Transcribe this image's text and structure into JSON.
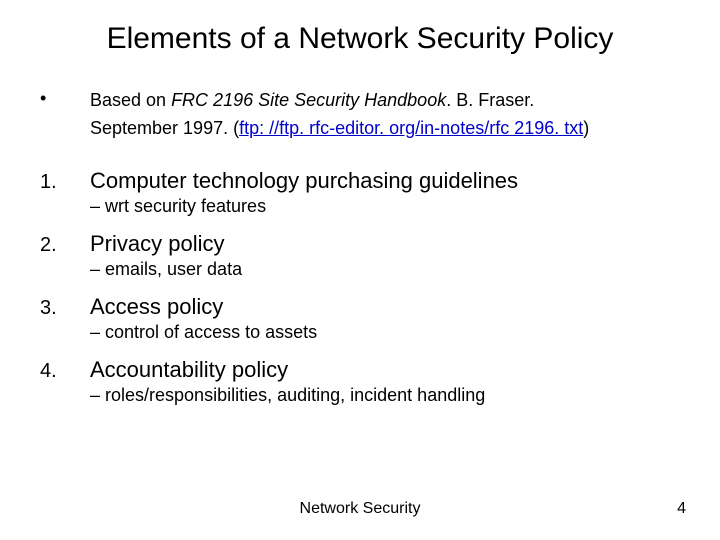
{
  "title": "Elements of a Network Security Policy",
  "source": {
    "prefix": "Based on ",
    "italic_ref": "FRC 2196 Site Security Handbook",
    "after_italic": ". B. Fraser.",
    "line2_prefix": "September 1997. (",
    "link_text": "ftp: //ftp. rfc-editor. org/in-notes/rfc 2196. txt",
    "line2_suffix": ")"
  },
  "items": [
    {
      "num": "1.",
      "label": "Computer technology purchasing guidelines",
      "note": "– wrt security features"
    },
    {
      "num": "2.",
      "label": "Privacy policy",
      "note": "– emails, user data"
    },
    {
      "num": "3.",
      "label": "Access policy",
      "note": "– control of access to assets"
    },
    {
      "num": "4.",
      "label": "Accountability policy",
      "note": "– roles/responsibilities, auditing, incident handling"
    }
  ],
  "footer": {
    "center": "Network Security",
    "page": "4"
  },
  "bullet_char": "•"
}
